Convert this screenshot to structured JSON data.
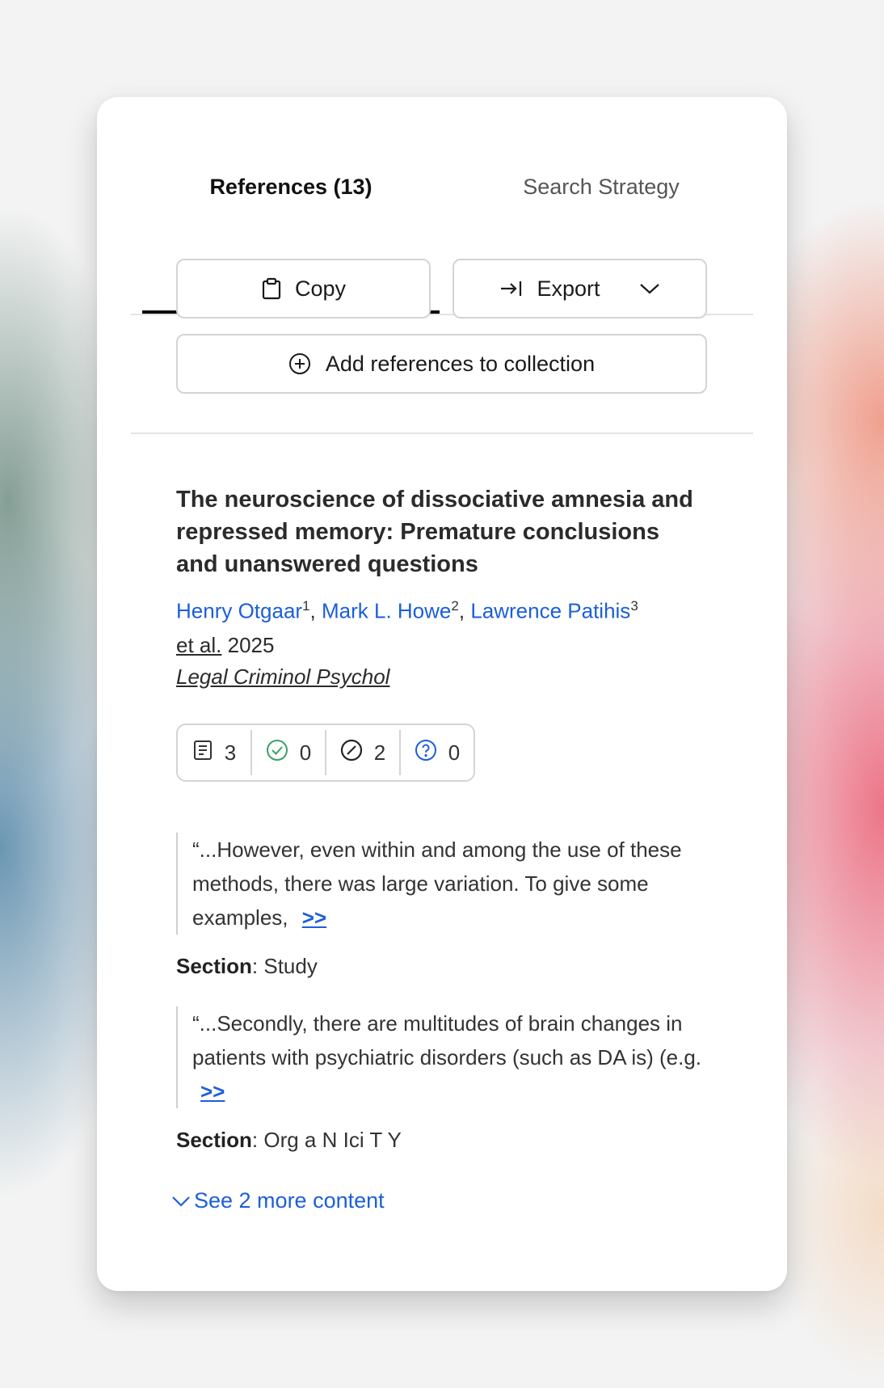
{
  "tabs": [
    {
      "label": "References (13)",
      "active": true
    },
    {
      "label": "Search Strategy",
      "active": false
    }
  ],
  "actions": {
    "copy_label": "Copy",
    "export_label": "Export",
    "add_label": "Add references to collection"
  },
  "reference": {
    "title": "The neuroscience of dissociative amnesia and repressed memory: Premature conclusions and unanswered questions",
    "authors": [
      {
        "name": "Henry Otgaar",
        "sup": "1"
      },
      {
        "name": "Mark L. Howe",
        "sup": "2"
      },
      {
        "name": "Lawrence Patihis",
        "sup": "3"
      }
    ],
    "et_al": "et al.",
    "year": "2025",
    "journal": "Legal Criminol Psychol",
    "stats": [
      {
        "icon": "document-icon",
        "count": "3"
      },
      {
        "icon": "check-circle-icon",
        "count": "0",
        "color": "#3aa06a"
      },
      {
        "icon": "slash-circle-icon",
        "count": "2"
      },
      {
        "icon": "question-circle-icon",
        "count": "0",
        "color": "#1b5fd9"
      }
    ],
    "excerpts": [
      {
        "text": "“...However, even within and among the use of these methods, there was large variation. To give some examples,",
        "more_label": ">>",
        "section_label": "Section",
        "section_value": ": Study"
      },
      {
        "text": "“...Secondly, there are multitudes of brain changes in patients with psychiatric disorders (such as DA is) (e.g.",
        "more_label": ">>",
        "section_label": "Section",
        "section_value": ": Org a N Ici T Y"
      }
    ],
    "see_more_label": "See 2 more content"
  },
  "colors": {
    "link": "#1b5fd9",
    "success": "#3aa06a"
  }
}
